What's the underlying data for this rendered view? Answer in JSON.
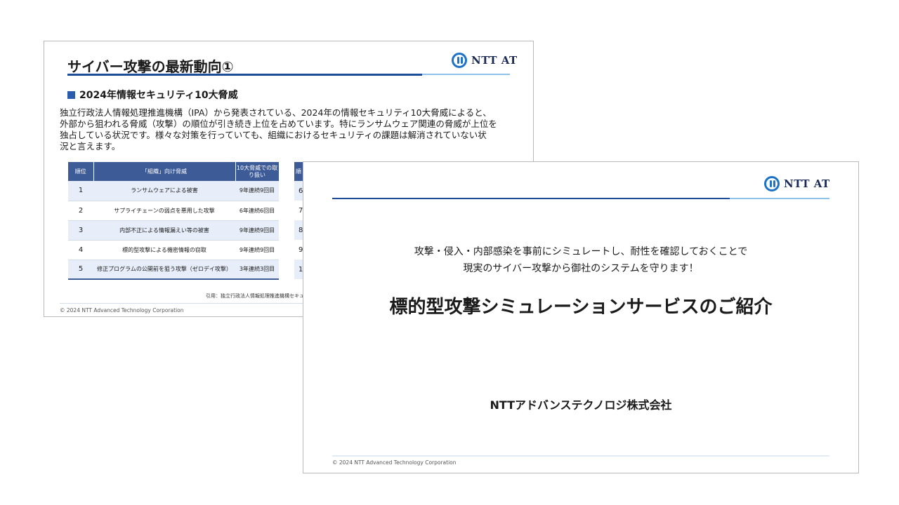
{
  "back_slide": {
    "title": "サイバー攻撃の最新動向①",
    "logo_text": "NTT AT",
    "subheading": "2024年情報セキュリティ10大脅威",
    "body_lines": [
      "独立行政法人情報処理推進機構（IPA）から発表されている、2024年の情報セキュリティ10大脅威によると、",
      "外部から狙われる脅威（攻撃）の順位が引き続き上位を占めています。特にランサムウェア関連の脅威が上位を",
      "独占している状況です。様々な対策を行っていても、組織におけるセキュリティの課題は解消されていない状",
      "況と言えます。"
    ],
    "table": {
      "headers": [
        "順位",
        "「組織」向け脅威",
        "10大脅威での取り扱い"
      ],
      "rows": [
        {
          "rank": "1",
          "threat": "ランサムウェアによる被害",
          "status": "9年連続9回目"
        },
        {
          "rank": "2",
          "threat": "サプライチェーンの弱点を悪用した攻撃",
          "status": "6年連続6回目"
        },
        {
          "rank": "3",
          "threat": "内部不正による情報漏えい等の被害",
          "status": "9年連続9回目"
        },
        {
          "rank": "4",
          "threat": "標的型攻撃による機密情報の窃取",
          "status": "9年連続9回目"
        },
        {
          "rank": "5",
          "threat": "修正プログラムの公開前を狙う攻撃（ゼロデイ攻撃）",
          "status": "3年連続3回目"
        }
      ]
    },
    "table2_partial": {
      "header": "順",
      "cells": [
        "6",
        "7",
        "8",
        "9",
        "1"
      ]
    },
    "citation": "引用：独立行政法人情報処理推進機構セキュリティ",
    "footer": "© 2024 NTT Advanced Technology Corporation"
  },
  "front_slide": {
    "logo_text": "NTT AT",
    "lead_line1": "攻撃・侵入・内部感染を事前にシミュレートし、耐性を確認しておくことで",
    "lead_line2": "現実のサイバー攻撃から御社のシステムを守ります！",
    "title": "標的型攻撃シミュレーションサービスのご紹介",
    "company": "NTTアドバンステクノロジ株式会社",
    "footer": "© 2024 NTT Advanced Technology Corporation"
  },
  "colors": {
    "brand_navy": "#1b4d98",
    "accent_light_blue": "#8fc2ea",
    "table_header": "#3d5b96",
    "table_stripe": "#e7eef9",
    "logo_blue": "#1e73c8"
  },
  "icons": [
    "ntt-at-logo-icon"
  ]
}
